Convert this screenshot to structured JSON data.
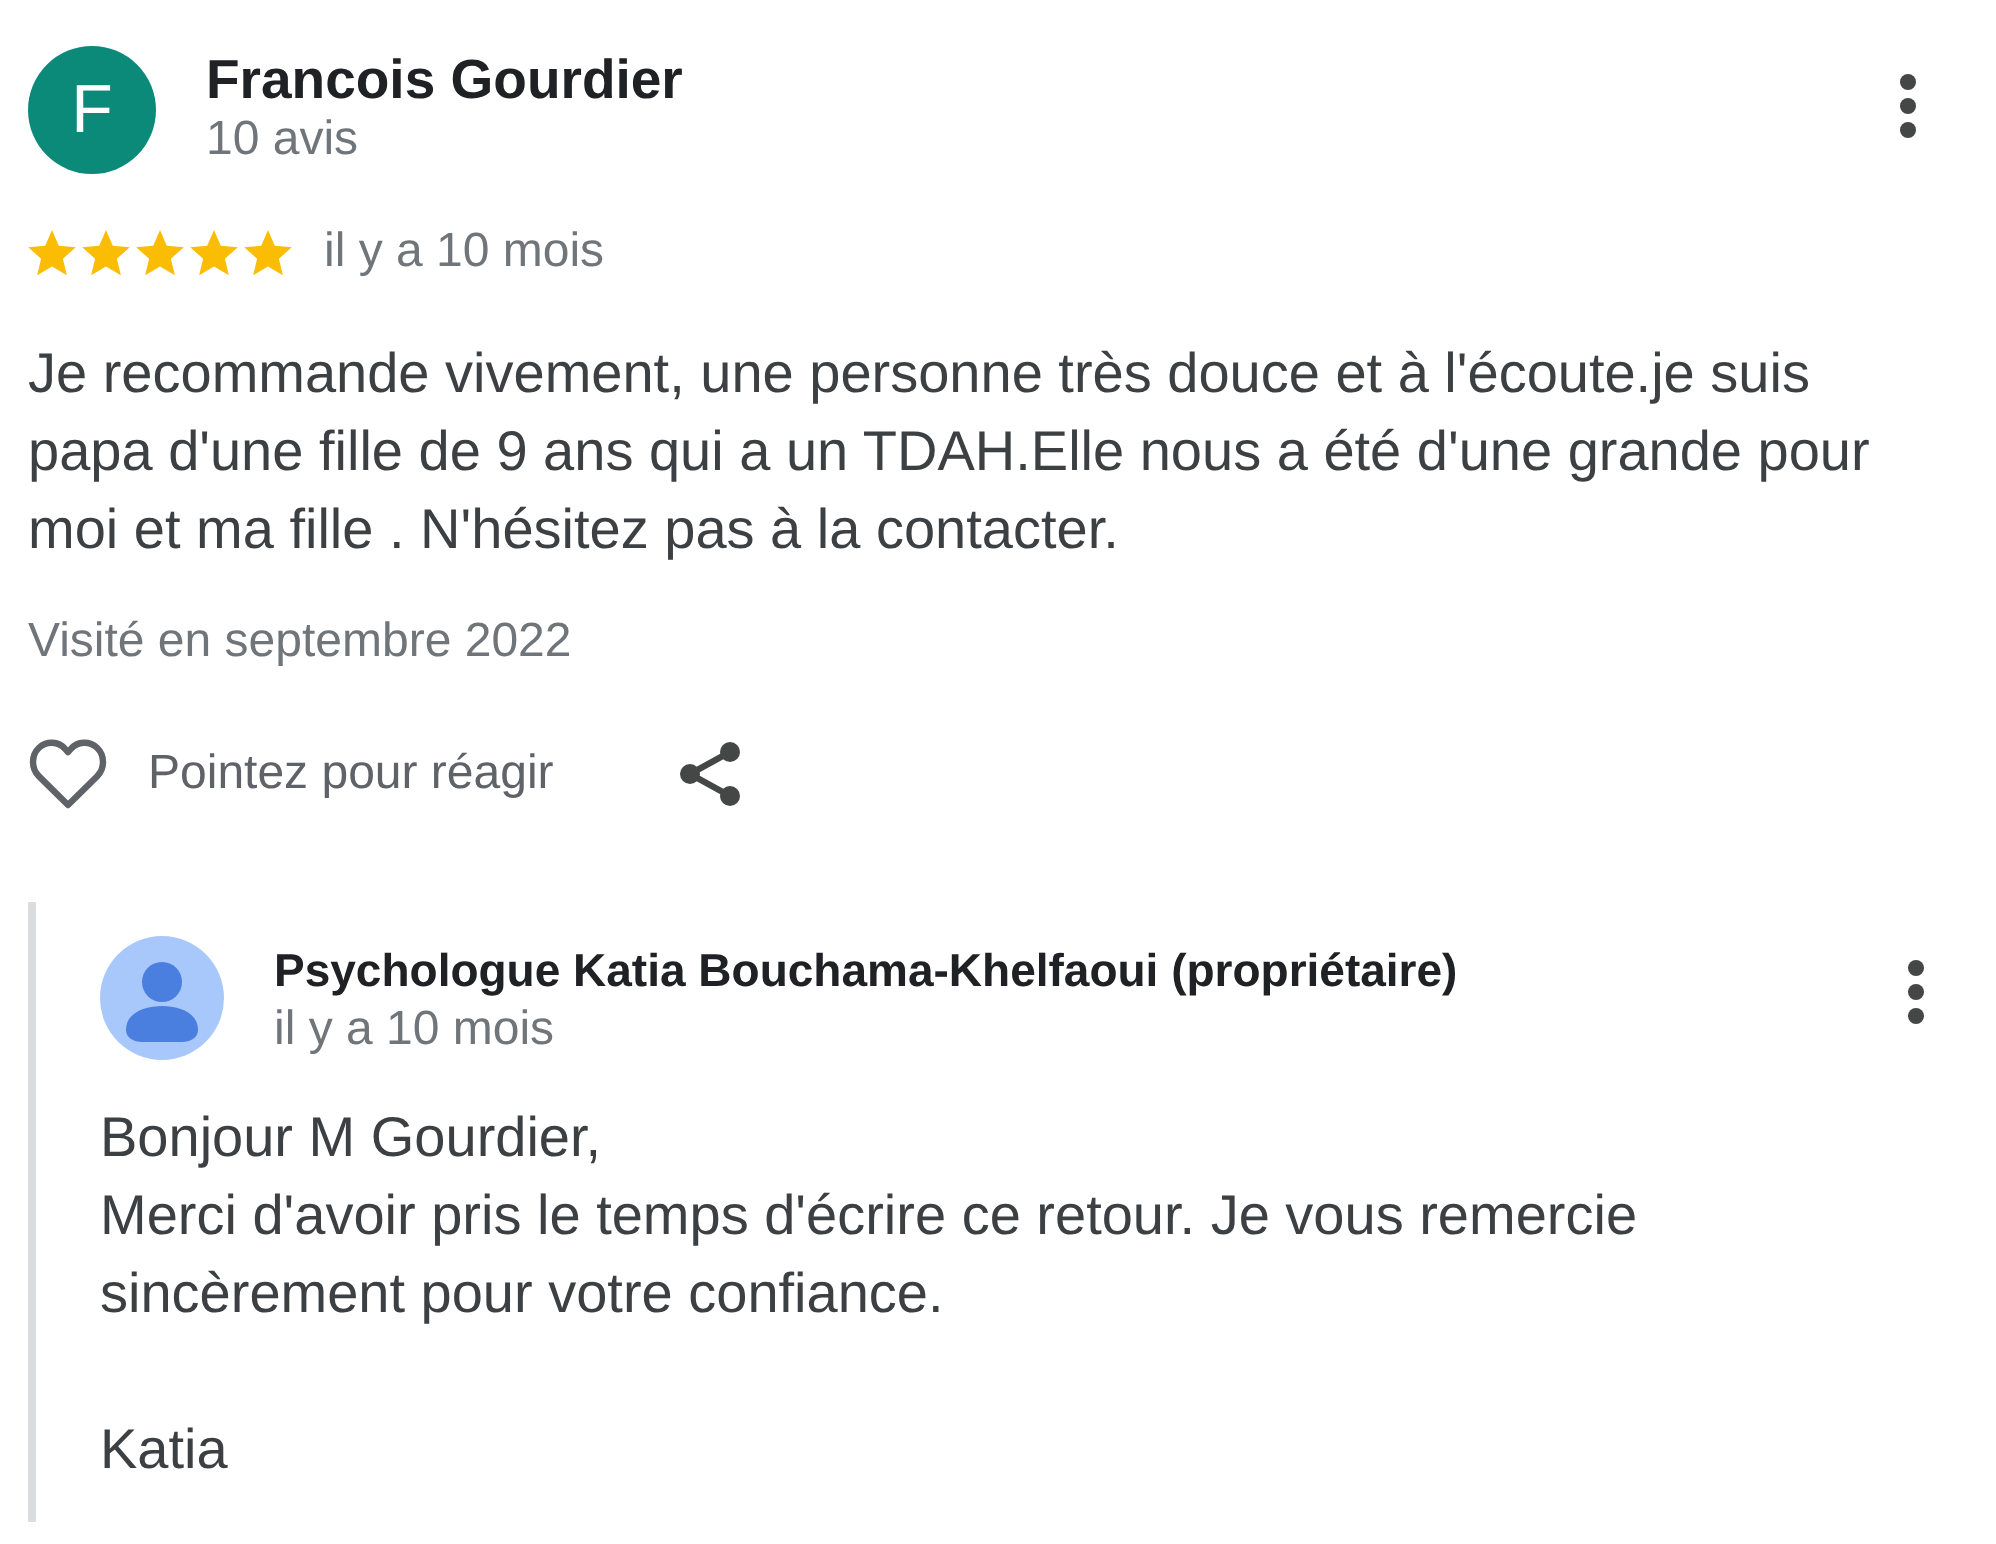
{
  "review": {
    "author": {
      "initial": "F",
      "name": "Francois Gourdier",
      "review_count": "10 avis"
    },
    "stars": 5,
    "time": "il y a 10 mois",
    "text": "Je recommande vivement, une personne très douce et à l'écoute.je suis papa d'une fille de 9 ans qui a un TDAH.Elle nous a été d'une grande pour moi et ma fille . N'hésitez pas à la contacter.",
    "visited": "Visité en septembre 2022",
    "react_label": "Pointez pour réagir"
  },
  "owner_reply": {
    "name": "Psychologue Katia Bouchama-Khelfaoui (propriétaire)",
    "time": "il y a 10 mois",
    "text": "Bonjour M Gourdier,\nMerci d'avoir pris le temps d'écrire ce retour. Je vous remercie sincèrement pour votre confiance.\n\nKatia"
  }
}
